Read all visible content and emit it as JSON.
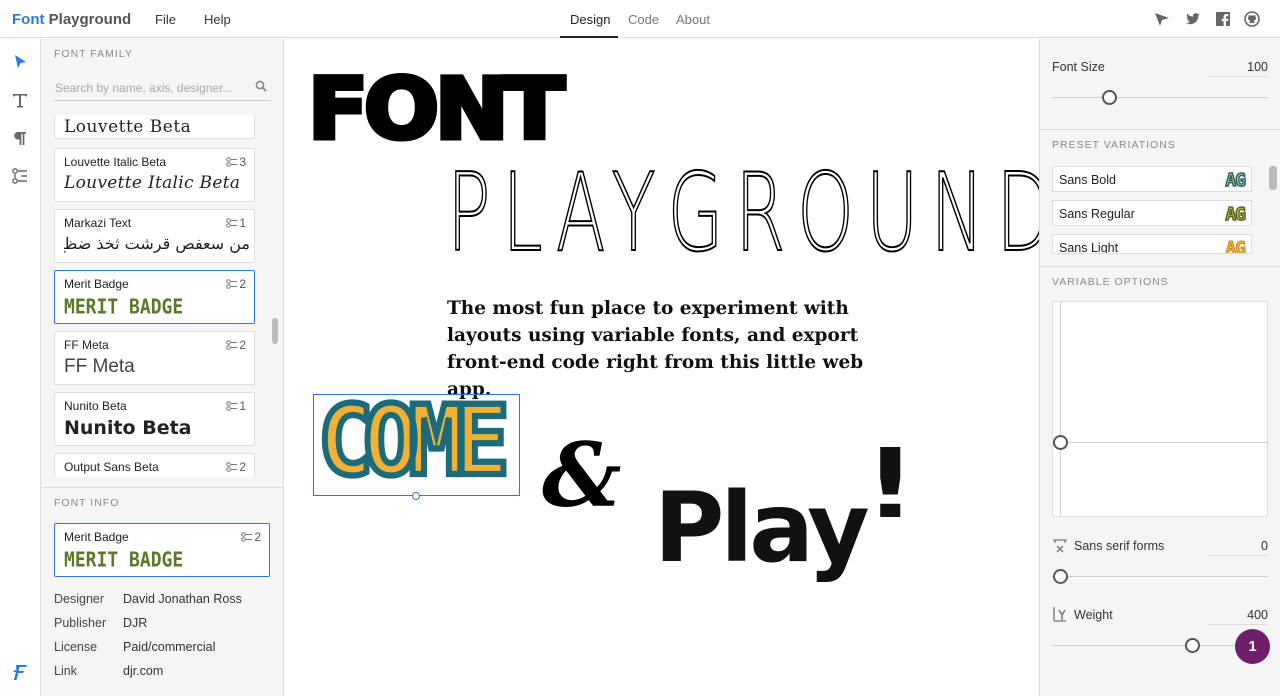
{
  "app": {
    "logo_part1": "Font",
    "logo_part2": "Playground"
  },
  "menu": [
    "File",
    "Help"
  ],
  "tabs": [
    {
      "label": "Design",
      "active": true
    },
    {
      "label": "Code",
      "active": false
    },
    {
      "label": "About",
      "active": false
    }
  ],
  "top_icons": [
    "send-icon",
    "twitter-icon",
    "facebook-icon",
    "github-icon"
  ],
  "tools": [
    "pointer-icon",
    "text-icon",
    "paragraph-icon",
    "variable-axes-icon",
    "fontplayground-icon"
  ],
  "font_family": {
    "title": "FONT FAMILY",
    "search_placeholder": "Search by name, axis, designer...",
    "items": [
      {
        "name": "",
        "count": "",
        "preview": "Louvette Beta"
      },
      {
        "name": "Louvette Italic Beta",
        "count": "3",
        "preview": "Louvette Italic Beta"
      },
      {
        "name": "Markazi Text",
        "count": "1",
        "preview": "من سعفص قرشت ثخذ ضظغ"
      },
      {
        "name": "Merit Badge",
        "count": "2",
        "preview": "MERIT BADGE",
        "selected": true
      },
      {
        "name": "FF Meta",
        "count": "2",
        "preview": "FF Meta"
      },
      {
        "name": "Nunito Beta",
        "count": "1",
        "preview": "Nunito Beta"
      },
      {
        "name": "Output Sans Beta",
        "count": "2",
        "preview": ""
      }
    ]
  },
  "font_info": {
    "title": "FONT INFO",
    "card": {
      "name": "Merit Badge",
      "count": "2",
      "preview": "MERIT BADGE"
    },
    "rows": [
      {
        "key": "Designer",
        "value": "David Jonathan Ross"
      },
      {
        "key": "Publisher",
        "value": "DJR"
      },
      {
        "key": "License",
        "value": "Paid/commercial"
      },
      {
        "key": "Link",
        "value": "djr.com"
      }
    ]
  },
  "canvas": {
    "word_font": "FONT",
    "word_playground": "PLAYGROUND",
    "paragraph": "The most fun place to experiment with layouts using variable fonts, and export front-end code right from this little web app.",
    "word_come": "COME",
    "ampersand": "&",
    "word_play": "Play",
    "exclaim": "!"
  },
  "right": {
    "font_size_label": "Font Size",
    "font_size_value": "100",
    "preset_title": "PRESET VARIATIONS",
    "presets": [
      {
        "label": "Sans Bold",
        "swatch": "AG"
      },
      {
        "label": "Sans Regular",
        "swatch": "AG"
      },
      {
        "label": "Sans Light",
        "swatch": "AG"
      }
    ],
    "variable_title": "VARIABLE OPTIONS",
    "sans_forms_label": "Sans serif forms",
    "sans_forms_value": "0",
    "weight_label": "Weight",
    "weight_value": "400"
  },
  "badge": "1",
  "colors": {
    "accent": "#2a7ae2",
    "teal": "#1b6b7a",
    "gold": "#f2b134",
    "badge": "#6d1f6b"
  }
}
